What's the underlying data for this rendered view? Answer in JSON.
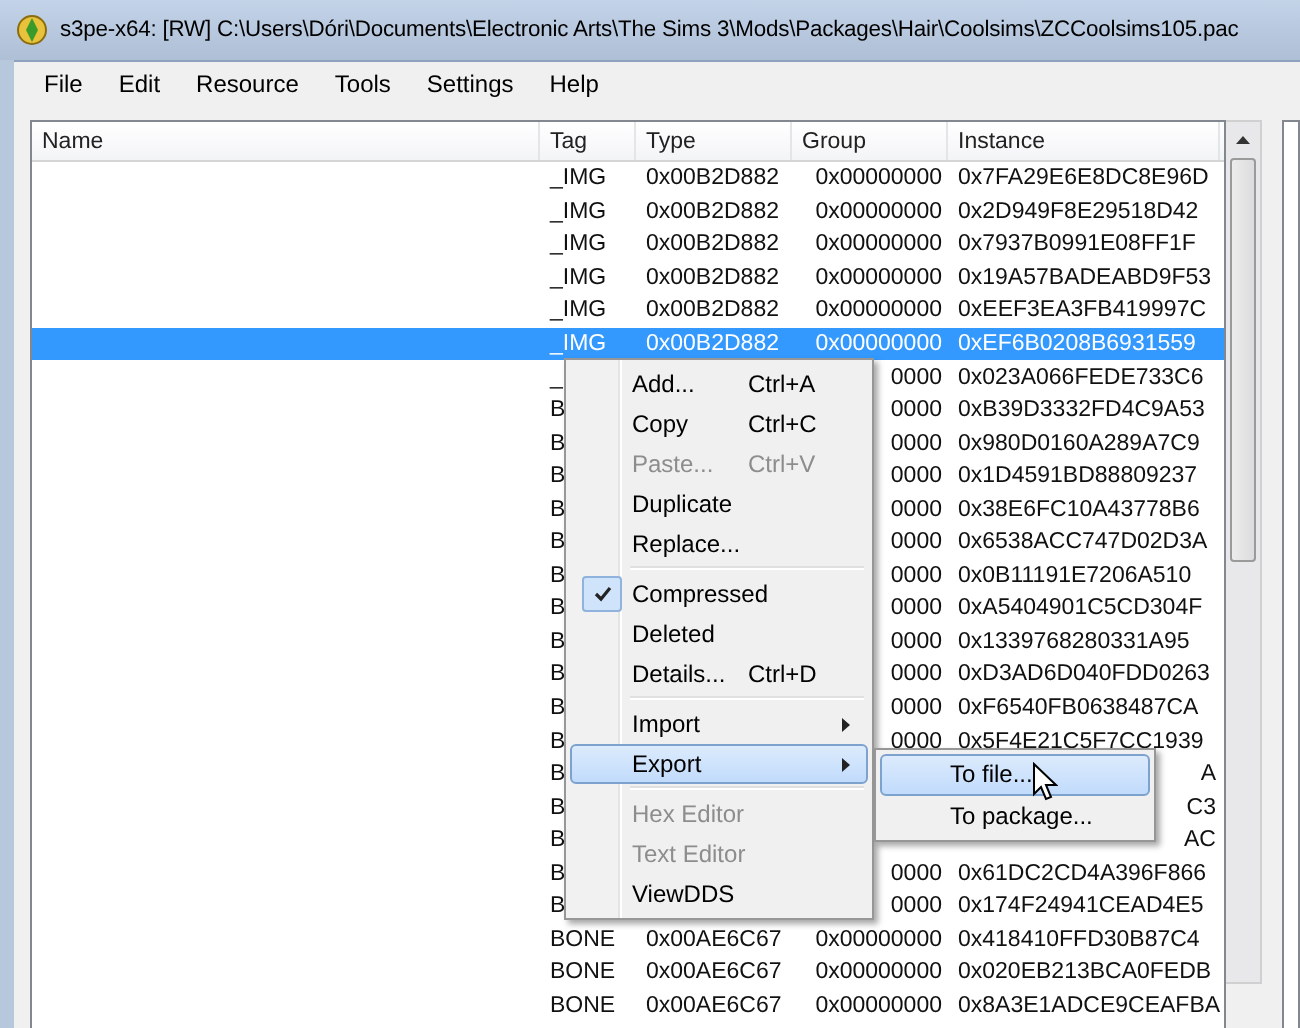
{
  "window": {
    "title": "s3pe-x64: [RW] C:\\Users\\Dóri\\Documents\\Electronic Arts\\The Sims 3\\Mods\\Packages\\Hair\\Coolsims\\ZCCoolsims105.pac"
  },
  "menu_bar": [
    "File",
    "Edit",
    "Resource",
    "Tools",
    "Settings",
    "Help"
  ],
  "table": {
    "columns": [
      "Name",
      "Tag",
      "Type",
      "Group",
      "Instance"
    ],
    "rows": [
      {
        "tag": "_IMG",
        "type": "0x00B2D882",
        "group": "0x00000000",
        "instance": "0x7FA29E6E8DC8E96D",
        "selected": false
      },
      {
        "tag": "_IMG",
        "type": "0x00B2D882",
        "group": "0x00000000",
        "instance": "0x2D949F8E29518D42",
        "selected": false
      },
      {
        "tag": "_IMG",
        "type": "0x00B2D882",
        "group": "0x00000000",
        "instance": "0x7937B0991E08FF1F",
        "selected": false
      },
      {
        "tag": "_IMG",
        "type": "0x00B2D882",
        "group": "0x00000000",
        "instance": "0x19A57BADEABD9F53",
        "selected": false
      },
      {
        "tag": "_IMG",
        "type": "0x00B2D882",
        "group": "0x00000000",
        "instance": "0xEEF3EA3FB419997C",
        "selected": false
      },
      {
        "tag": "_IMG",
        "type": "0x00B2D882",
        "group": "0x00000000",
        "instance": "0xEF6B0208B6931559",
        "selected": true
      },
      {
        "tag": "_",
        "group": "0000",
        "instance": "0x023A066FEDE733C6",
        "selected": false
      },
      {
        "tag": "B",
        "group": "0000",
        "instance": "0xB39D3332FD4C9A53",
        "selected": false
      },
      {
        "tag": "B",
        "group": "0000",
        "instance": "0x980D0160A289A7C9",
        "selected": false
      },
      {
        "tag": "B",
        "group": "0000",
        "instance": "0x1D4591BD88809237",
        "selected": false
      },
      {
        "tag": "B",
        "group": "0000",
        "instance": "0x38E6FC10A43778B6",
        "selected": false
      },
      {
        "tag": "B",
        "group": "0000",
        "instance": "0x6538ACC747D02D3A",
        "selected": false
      },
      {
        "tag": "B",
        "group": "0000",
        "instance": "0x0B11191E7206A510",
        "selected": false
      },
      {
        "tag": "B",
        "group": "0000",
        "instance": "0xA5404901C5CD304F",
        "selected": false
      },
      {
        "tag": "B",
        "group": "0000",
        "instance": "0x1339768280331A95",
        "selected": false
      },
      {
        "tag": "B",
        "group": "0000",
        "instance": "0xD3AD6D040FDD0263",
        "selected": false
      },
      {
        "tag": "B",
        "group": "0000",
        "instance": "0xF6540FB0638487CA",
        "selected": false
      },
      {
        "tag": "B",
        "group": "0000",
        "instance": "0x5F4E21C5F7CC1939",
        "selected": false
      },
      {
        "tag": "B",
        "instance": "A",
        "selected": false
      },
      {
        "tag": "B",
        "instance": "C3",
        "selected": false
      },
      {
        "tag": "B",
        "instance": "AC",
        "selected": false
      },
      {
        "tag": "B",
        "group": "0000",
        "instance": "0x61DC2CD4A396F866",
        "selected": false
      },
      {
        "tag": "B",
        "group": "0000",
        "instance": "0x174F24941CEAD4E5",
        "selected": false
      },
      {
        "tag": "BONE",
        "type": "0x00AE6C67",
        "group": "0x00000000",
        "instance": "0x418410FFD30B87C4",
        "selected": false
      },
      {
        "tag": "BONE",
        "type": "0x00AE6C67",
        "group": "0x00000000",
        "instance": "0x020EB213BCA0FEDB",
        "selected": false
      },
      {
        "tag": "BONE",
        "type": "0x00AE6C67",
        "group": "0x00000000",
        "instance": "0x8A3E1ADCE9CEAFBA",
        "selected": false
      }
    ]
  },
  "context_menu": {
    "items": [
      {
        "kind": "item",
        "label": "Add...",
        "shortcut": "Ctrl+A",
        "disabled": false,
        "checked": false,
        "has_submenu": false,
        "selected": false
      },
      {
        "kind": "item",
        "label": "Copy",
        "shortcut": "Ctrl+C",
        "disabled": false,
        "checked": false,
        "has_submenu": false,
        "selected": false
      },
      {
        "kind": "item",
        "label": "Paste...",
        "shortcut": "Ctrl+V",
        "disabled": true,
        "checked": false,
        "has_submenu": false,
        "selected": false
      },
      {
        "kind": "item",
        "label": "Duplicate",
        "disabled": false,
        "checked": false,
        "has_submenu": false,
        "selected": false
      },
      {
        "kind": "item",
        "label": "Replace...",
        "disabled": false,
        "checked": false,
        "has_submenu": false,
        "selected": false
      },
      {
        "kind": "separator"
      },
      {
        "kind": "item",
        "label": "Compressed",
        "disabled": false,
        "checked": true,
        "has_submenu": false,
        "selected": false
      },
      {
        "kind": "item",
        "label": "Deleted",
        "disabled": false,
        "checked": false,
        "has_submenu": false,
        "selected": false
      },
      {
        "kind": "item",
        "label": "Details...",
        "shortcut": "Ctrl+D",
        "disabled": false,
        "checked": false,
        "has_submenu": false,
        "selected": false
      },
      {
        "kind": "separator"
      },
      {
        "kind": "item",
        "label": "Import",
        "disabled": false,
        "checked": false,
        "has_submenu": true,
        "selected": false
      },
      {
        "kind": "item",
        "label": "Export",
        "disabled": false,
        "checked": false,
        "has_submenu": true,
        "selected": true
      },
      {
        "kind": "separator"
      },
      {
        "kind": "item",
        "label": "Hex Editor",
        "disabled": true,
        "checked": false,
        "has_submenu": false,
        "selected": false
      },
      {
        "kind": "item",
        "label": "Text Editor",
        "disabled": true,
        "checked": false,
        "has_submenu": false,
        "selected": false
      },
      {
        "kind": "item",
        "label": "ViewDDS",
        "disabled": false,
        "checked": false,
        "has_submenu": false,
        "selected": false
      }
    ]
  },
  "submenu": {
    "items": [
      {
        "label": "To file...",
        "selected": true
      },
      {
        "label": "To package...",
        "selected": false
      }
    ]
  }
}
